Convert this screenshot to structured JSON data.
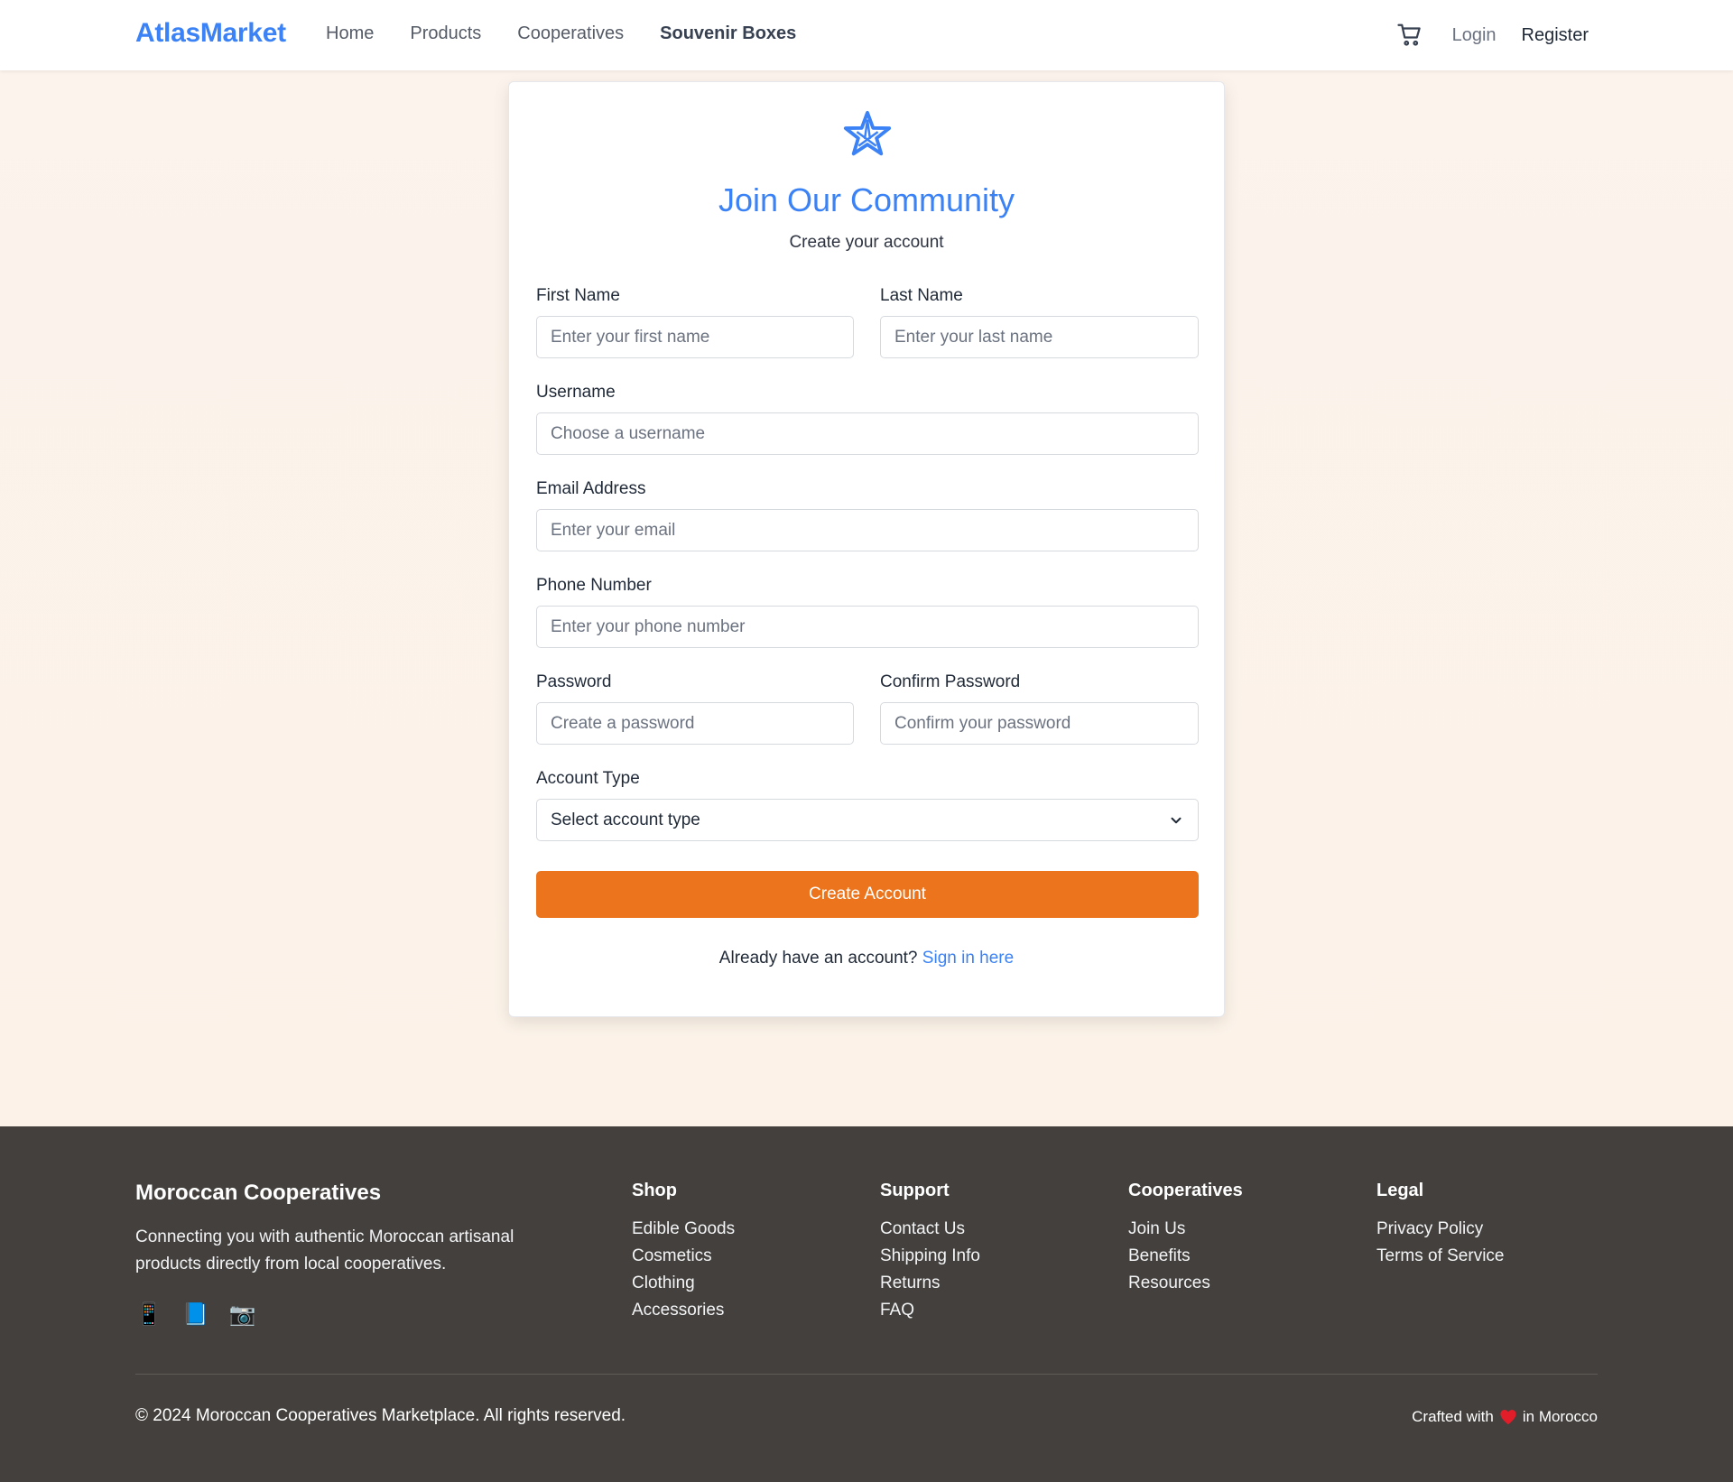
{
  "nav": {
    "brand": "AtlasMarket",
    "links": [
      "Home",
      "Products",
      "Cooperatives",
      "Souvenir Boxes"
    ],
    "active_link": "Souvenir Boxes",
    "login": "Login",
    "register": "Register",
    "cart_icon": "shopping-cart-icon"
  },
  "form": {
    "logo_icon": "star-emblem-icon",
    "title": "Join Our Community",
    "subtitle": "Create your account",
    "first_name": {
      "label": "First Name",
      "placeholder": "Enter your first name"
    },
    "last_name": {
      "label": "Last Name",
      "placeholder": "Enter your last name"
    },
    "username": {
      "label": "Username",
      "placeholder": "Choose a username"
    },
    "email": {
      "label": "Email Address",
      "placeholder": "Enter your email"
    },
    "phone": {
      "label": "Phone Number",
      "placeholder": "Enter your phone number"
    },
    "password": {
      "label": "Password",
      "placeholder": "Create a password"
    },
    "confirm_password": {
      "label": "Confirm Password",
      "placeholder": "Confirm your password"
    },
    "account_type": {
      "label": "Account Type",
      "value": "Select account type"
    },
    "submit": "Create Account",
    "signin_prompt": "Already have an account?",
    "signin_link": "Sign in here"
  },
  "footer": {
    "about_title": "Moroccan Cooperatives",
    "about_text": "Connecting you with authentic Moroccan artisanal products directly from local cooperatives.",
    "socials": [
      "📱",
      "📘",
      "📷"
    ],
    "columns": [
      {
        "title": "Shop",
        "links": [
          "Edible Goods",
          "Cosmetics",
          "Clothing",
          "Accessories"
        ]
      },
      {
        "title": "Support",
        "links": [
          "Contact Us",
          "Shipping Info",
          "Returns",
          "FAQ"
        ]
      },
      {
        "title": "Cooperatives",
        "links": [
          "Join Us",
          "Benefits",
          "Resources"
        ]
      },
      {
        "title": "Legal",
        "links": [
          "Privacy Policy",
          "Terms of Service"
        ]
      }
    ],
    "copyright": "© 2024 Moroccan Cooperatives Marketplace. All rights reserved.",
    "crafted_prefix": "Crafted with",
    "crafted_suffix": "in Morocco"
  },
  "colors": {
    "accent_blue": "#3b82f6",
    "button_orange": "#ec741c",
    "footer_bg": "#43403d",
    "heart": "#e11d2a"
  }
}
